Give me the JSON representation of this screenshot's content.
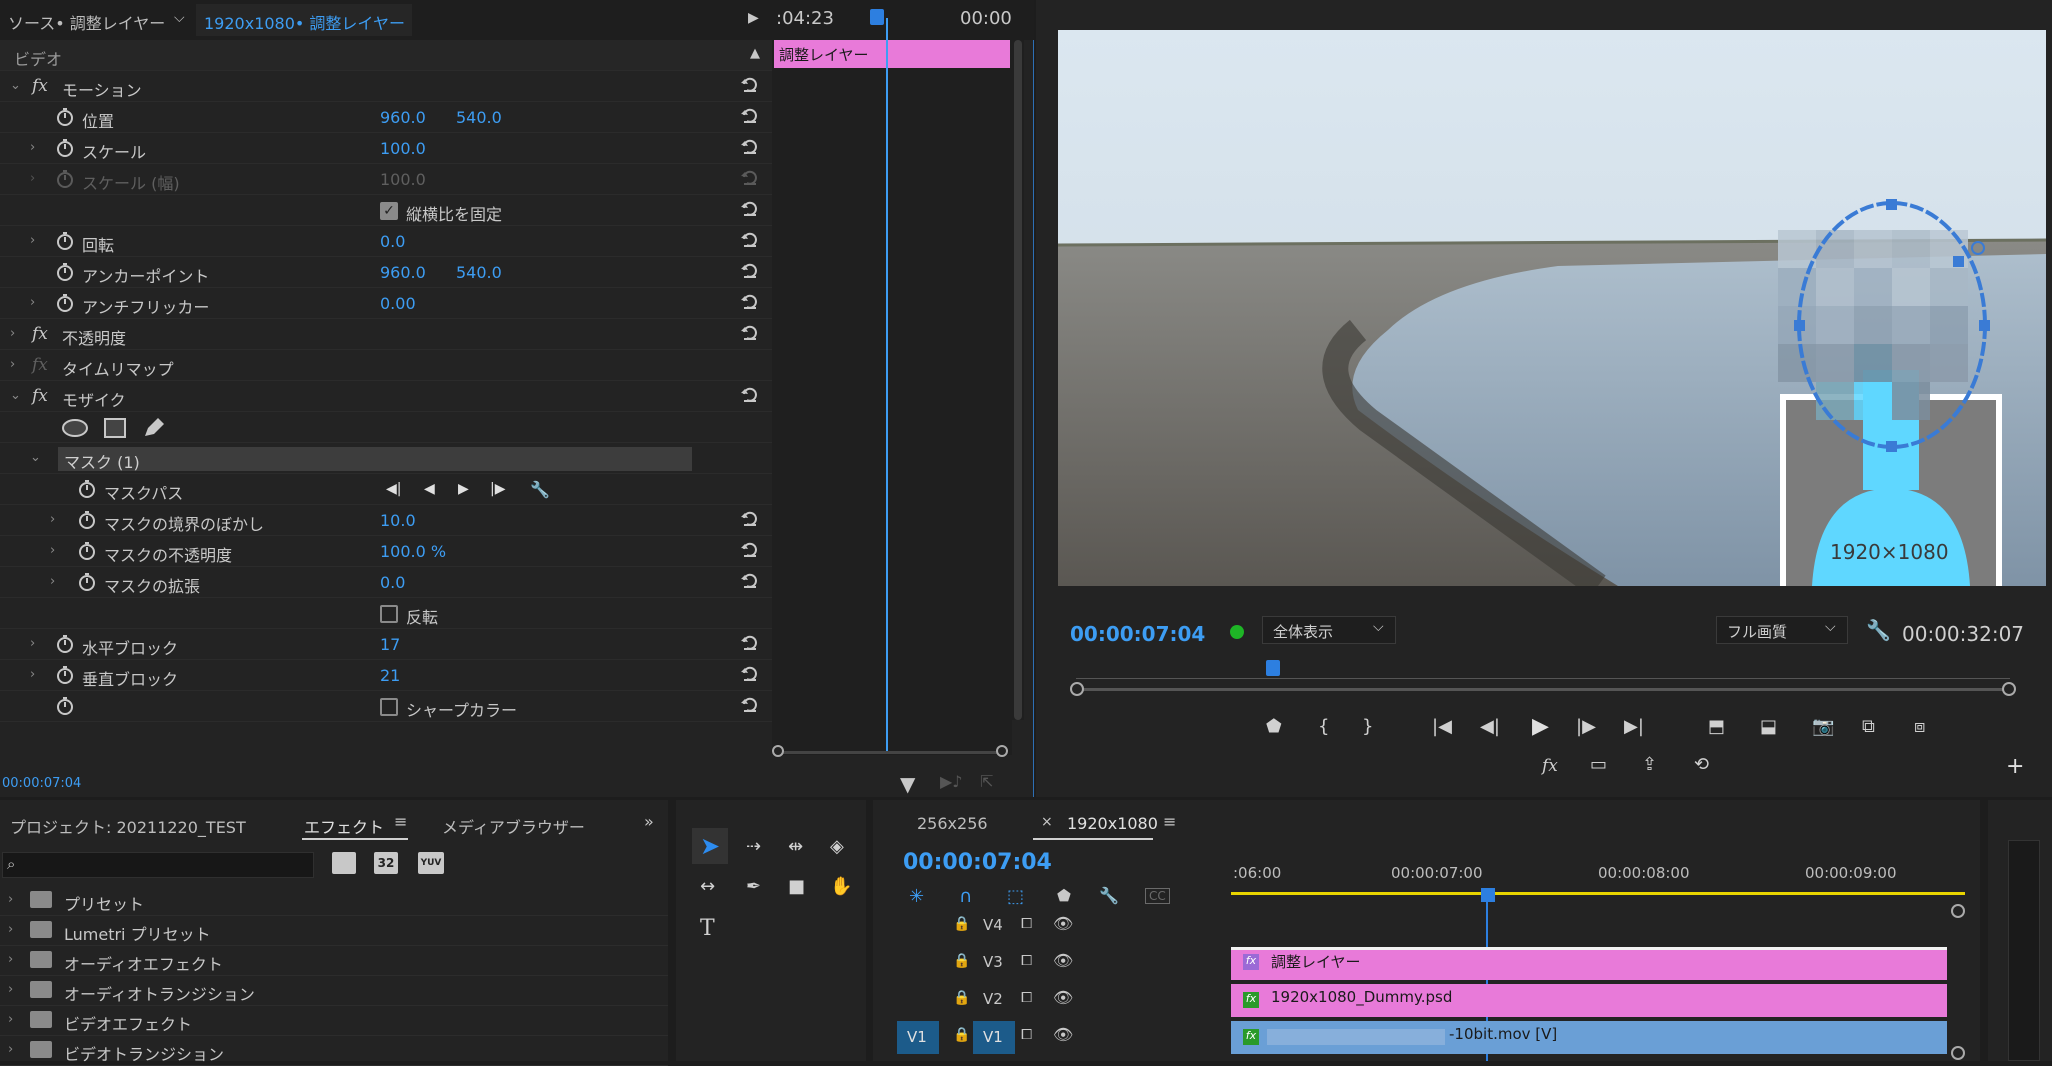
{
  "effect_controls": {
    "source_tab": "ソース• 調整レイヤー",
    "sequence_tab": "1920x1080• 調整レイヤー",
    "timecode_start": ":04:23",
    "timecode_end": "00:00",
    "clip_label": "調整レイヤー",
    "section": "ビデオ",
    "motion": "モーション",
    "position_label": "位置",
    "position_x": "960.0",
    "position_y": "540.0",
    "scale_label": "スケール",
    "scale_value": "100.0",
    "scale_width_label": "スケール (幅)",
    "scale_width_value": "100.0",
    "uniform_scale_label": "縦横比を固定",
    "rotation_label": "回転",
    "rotation_value": "0.0",
    "anchor_label": "アンカーポイント",
    "anchor_x": "960.0",
    "anchor_y": "540.0",
    "flicker_label": "アンチフリッカー",
    "flicker_value": "0.00",
    "opacity": "不透明度",
    "time_remap": "タイムリマップ",
    "mosaic": "モザイク",
    "mask_title": "マスク (1)",
    "mask_path_label": "マスクパス",
    "mask_feather_label": "マスクの境界のぼかし",
    "mask_feather_value": "10.0",
    "mask_opacity_label": "マスクの不透明度",
    "mask_opacity_value": "100.0 %",
    "mask_expansion_label": "マスクの拡張",
    "mask_expansion_value": "0.0",
    "inverted_label": "反転",
    "horizontal_blocks_label": "水平ブロック",
    "horizontal_blocks_value": "17",
    "vertical_blocks_label": "垂直ブロック",
    "vertical_blocks_value": "21",
    "sharp_colors_label": "シャープカラー",
    "footer_timecode": "00:00:07:04"
  },
  "program_monitor": {
    "timecode": "00:00:07:04",
    "fit_select": "全体表示",
    "quality_select": "フル画質",
    "duration": "00:00:32:07",
    "overlay_text": "1920×1080"
  },
  "project_panel": {
    "project_tab": "プロジェクト: 20211220_TEST",
    "effects_tab": "エフェクト",
    "media_tab": "メディアブラウザー",
    "search_placeholder": "",
    "badge_32": "32",
    "badge_yuv": "YUV",
    "items": [
      {
        "label": "プリセット"
      },
      {
        "label": "Lumetri プリセット"
      },
      {
        "label": "オーディオエフェクト"
      },
      {
        "label": "オーディオトランジション"
      },
      {
        "label": "ビデオエフェクト"
      },
      {
        "label": "ビデオトランジション"
      }
    ]
  },
  "timeline": {
    "tab_1": "256x256",
    "tab_2": "1920x1080",
    "timecode": "00:00:07:04",
    "ruler": [
      ":06:00",
      "00:00:07:00",
      "00:00:08:00",
      "00:00:09:00"
    ],
    "tracks": [
      {
        "name": "V4"
      },
      {
        "name": "V3",
        "clip": "調整レイヤー"
      },
      {
        "name": "V2",
        "clip": "1920x1080_Dummy.psd"
      },
      {
        "name": "V1",
        "source": "V1",
        "clip": "-10bit.mov [V]"
      }
    ]
  },
  "colors": {
    "accent": "#3d9df3",
    "clip_pink": "#e87ad9",
    "clip_blue": "#6a9fd6",
    "playhead": "#2d7fe0"
  }
}
